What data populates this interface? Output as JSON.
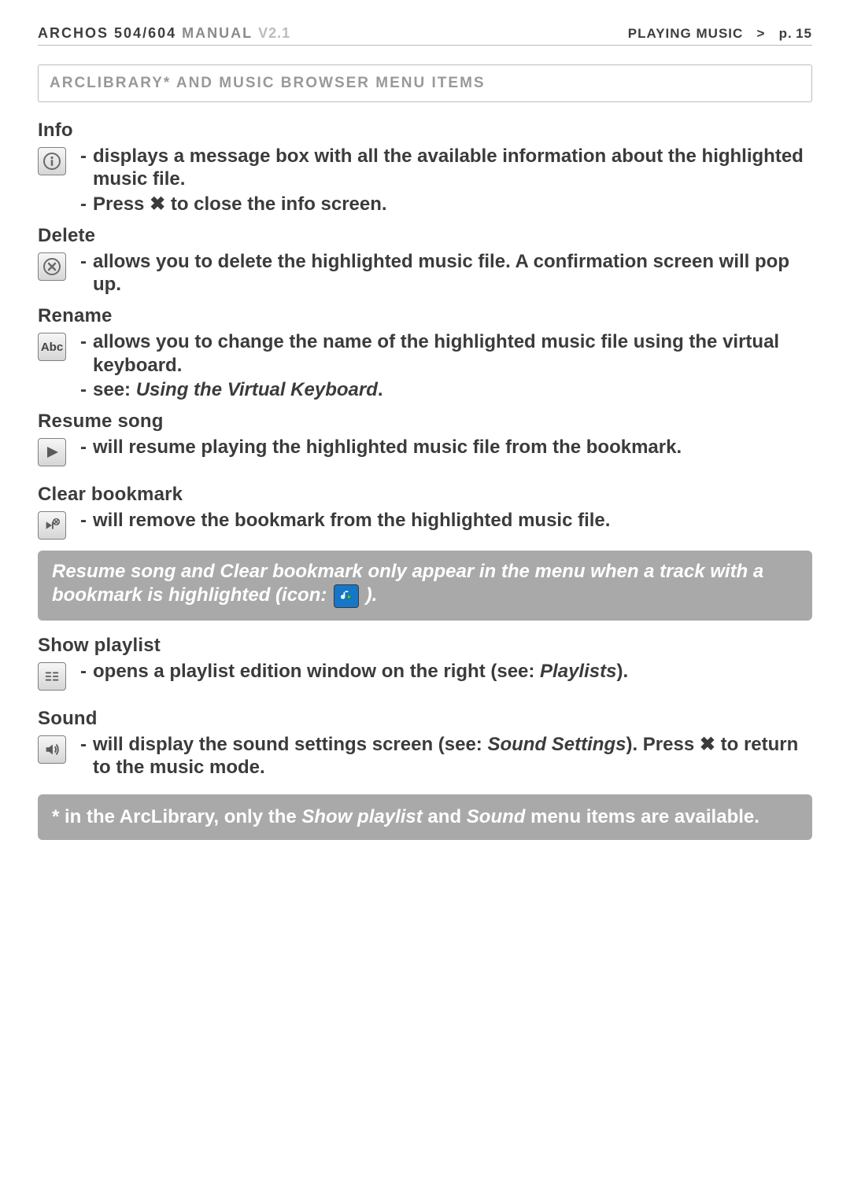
{
  "header": {
    "brand": "ARCHOS",
    "model": "504/604",
    "manual": "MANUAL",
    "version": "V2.1",
    "section": "PLAYING MUSIC",
    "chev": ">",
    "page": "p. 15"
  },
  "section_title": "ARCLIBRARY* AND MUSIC BROWSER MENU ITEMS",
  "items": {
    "info": {
      "name": "Info",
      "b1": "displays a message box with all the available information about the highlight­ed music file.",
      "b2a": "Press ",
      "b2x": "✖",
      "b2b": " to close the info screen."
    },
    "delete": {
      "name": "Delete",
      "b1": "allows you to delete the highlighted music file. A confirmation screen will pop up."
    },
    "rename": {
      "name": "Rename",
      "b1": "allows you to change the name of the highlighted music file using the virtual keyboard.",
      "b2a": "see: ",
      "b2ref": "Using the Virtual Keyboard",
      "b2b": "."
    },
    "resume": {
      "name": "Resume song",
      "b1": "will resume playing the highlighted music file from the bookmark."
    },
    "clear": {
      "name": "Clear bookmark",
      "b1": "will remove the bookmark from the highlighted music file."
    },
    "showpl": {
      "name": "Show playlist",
      "b1a": "opens a playlist edition window on the right (see: ",
      "b1ref": "Playlists",
      "b1b": ")."
    },
    "sound": {
      "name": "Sound",
      "b1a": "will display the sound settings screen (see: ",
      "b1ref": "Sound Settings",
      "b1b": "). Press ",
      "b1x": "✖",
      "b1c": " to return to the music mode."
    }
  },
  "note": {
    "a": "Resume song and Clear bookmark only appear in the menu when a track with a bookmark is highlighted (icon: ",
    "b": " )."
  },
  "foot": {
    "a": "* in the ArcLibrary, only the ",
    "em1": "Show playlist",
    "mid": " and ",
    "em2": "Sound",
    "b": " menu items are available."
  }
}
